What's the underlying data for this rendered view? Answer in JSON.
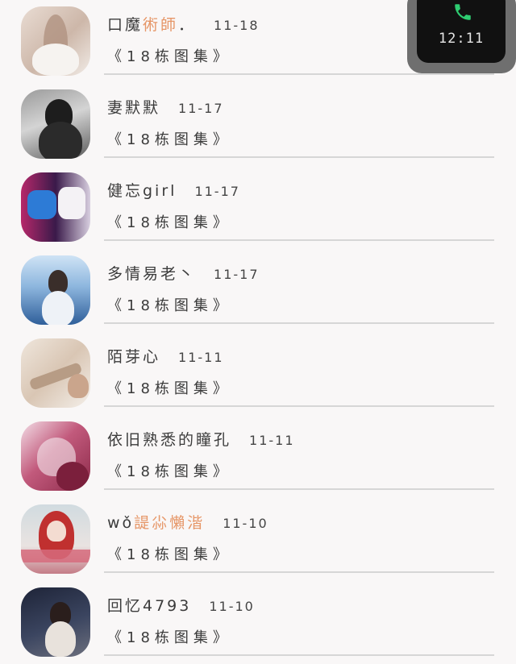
{
  "rows": [
    {
      "name_plain": "口魔",
      "name_highlight": "術師",
      "name_suffix": "．",
      "date": "11-18",
      "group": "《18栋图集》"
    },
    {
      "name_plain": "妻默默",
      "name_highlight": "",
      "name_suffix": "",
      "date": "11-17",
      "group": "《18栋图集》"
    },
    {
      "name_plain": "健忘girl",
      "name_highlight": "",
      "name_suffix": "",
      "date": "11-17",
      "group": "《18栋图集》"
    },
    {
      "name_plain": "多情易老丶",
      "name_highlight": "",
      "name_suffix": "",
      "date": "11-17",
      "group": "《18栋图集》"
    },
    {
      "name_plain": "陌芽心",
      "name_highlight": "",
      "name_suffix": "",
      "date": "11-11",
      "group": "《18栋图集》"
    },
    {
      "name_plain": "依旧熟悉的瞳孔",
      "name_highlight": "",
      "name_suffix": "",
      "date": "11-11",
      "group": "《18栋图集》"
    },
    {
      "name_plain": "wǒ",
      "name_highlight": "諟尛懶湝",
      "name_suffix": "",
      "date": "11-10",
      "group": "《18栋图集》"
    },
    {
      "name_plain": "回忆4793",
      "name_highlight": "",
      "name_suffix": "",
      "date": "11-10",
      "group": "《18栋图集》"
    }
  ],
  "call_widget": {
    "time": "12:11",
    "icon": "phone-icon",
    "icon_color": "#2ecc71"
  },
  "colors": {
    "background": "#f9f7f7",
    "highlight": "#e69667",
    "divider": "#d6d6d6"
  }
}
